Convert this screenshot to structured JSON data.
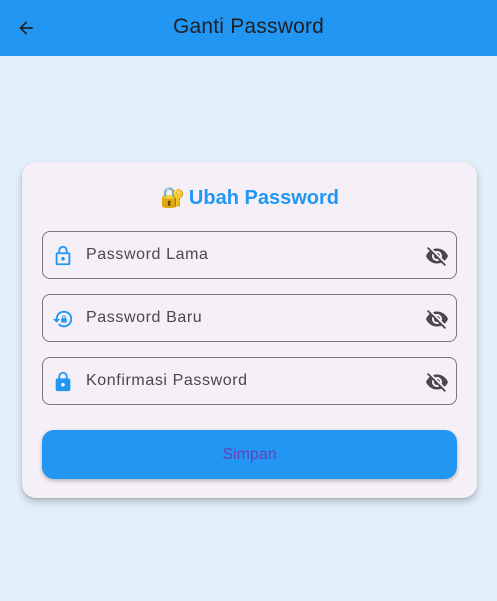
{
  "appbar": {
    "title": "Ganti Password",
    "back_icon": "arrow-back-icon"
  },
  "card": {
    "title_emoji": "🔐",
    "title": "Ubah Password",
    "fields": [
      {
        "placeholder": "Password Lama",
        "value": "",
        "icon": "lock-outline-icon",
        "toggle_icon": "visibility-off-icon"
      },
      {
        "placeholder": "Password Baru",
        "value": "",
        "icon": "lock-reset-icon",
        "toggle_icon": "visibility-off-icon"
      },
      {
        "placeholder": "Konfirmasi Password",
        "value": "",
        "icon": "lock-icon",
        "toggle_icon": "visibility-off-icon"
      }
    ],
    "save_label": "Simpan"
  },
  "colors": {
    "primary": "#2196f3",
    "background": "#e3f0fc",
    "card": "#f5f0f7",
    "button_text": "#6a3fb8"
  }
}
